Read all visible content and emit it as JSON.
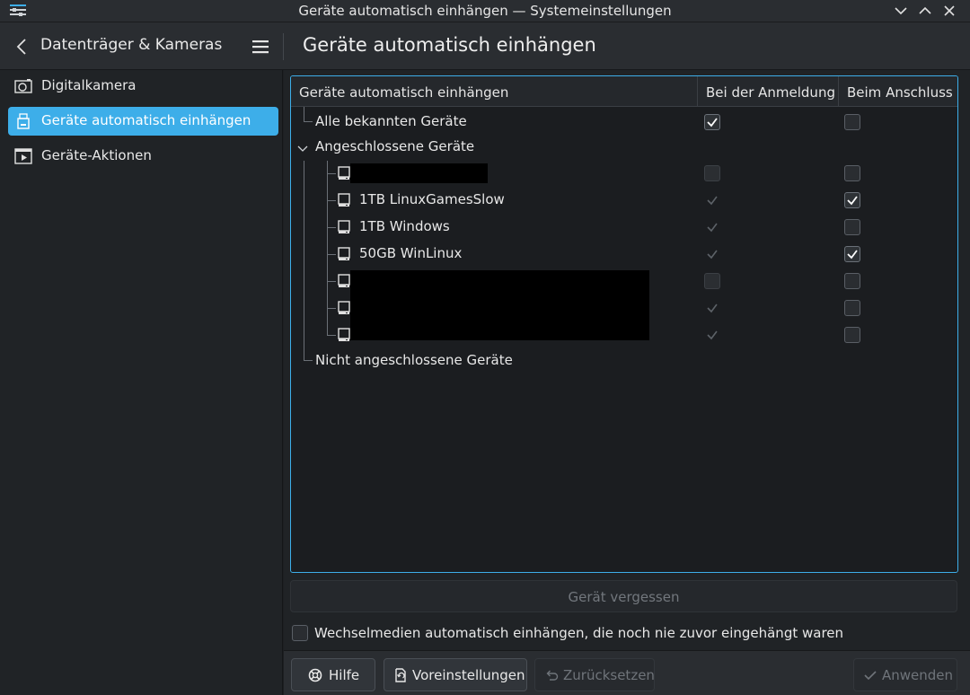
{
  "window": {
    "title": "Geräte automatisch einhängen — Systemeinstellungen"
  },
  "header": {
    "sidebar_title": "Datenträger & Kameras",
    "page_title": "Geräte automatisch einhängen"
  },
  "sidebar": {
    "items": [
      {
        "label": "Digitalkamera",
        "icon": "camera-icon",
        "active": false
      },
      {
        "label": "Geräte automatisch einhängen",
        "icon": "usb-drive-icon",
        "active": true
      },
      {
        "label": "Geräte-Aktionen",
        "icon": "play-window-icon",
        "active": false
      }
    ]
  },
  "tree": {
    "columns": [
      "Geräte automatisch einhängen",
      "Bei der Anmeldung",
      "Beim Anschluss"
    ],
    "all_known": {
      "label": "Alle bekannten Geräte",
      "login": true,
      "attach": false
    },
    "connected_group": {
      "label": "Angeschlossene Geräte",
      "expanded": true
    },
    "devices": [
      {
        "label": "",
        "redacted": true,
        "login": false,
        "attach": false,
        "login_enabled": true
      },
      {
        "label": "1TB LinuxGamesSlow",
        "redacted": false,
        "login": true,
        "attach": true,
        "login_enabled": false
      },
      {
        "label": "1TB Windows",
        "redacted": false,
        "login": true,
        "attach": false,
        "login_enabled": false
      },
      {
        "label": "50GB WinLinux",
        "redacted": false,
        "login": true,
        "attach": true,
        "login_enabled": false
      },
      {
        "label": "",
        "redacted": true,
        "login": false,
        "attach": false,
        "login_enabled": false
      },
      {
        "label": "",
        "redacted": true,
        "login": true,
        "attach": false,
        "login_enabled": false
      },
      {
        "label": "",
        "redacted": true,
        "login": true,
        "attach": false,
        "login_enabled": false
      }
    ],
    "disconnected_group": {
      "label": "Nicht angeschlossene Geräte"
    }
  },
  "forget_button": {
    "label": "Gerät vergessen",
    "enabled": false
  },
  "option": {
    "label": "Wechselmedien automatisch einhängen, die noch nie zuvor eingehängt waren",
    "checked": false
  },
  "footer": {
    "help_label": "Hilfe",
    "defaults_label": "Voreinstellungen",
    "reset_label": "Zurücksetzen",
    "apply_label": "Anwenden"
  },
  "colors": {
    "accent": "#3daee9",
    "background": "#202326",
    "window_chrome": "#2a2d31"
  }
}
